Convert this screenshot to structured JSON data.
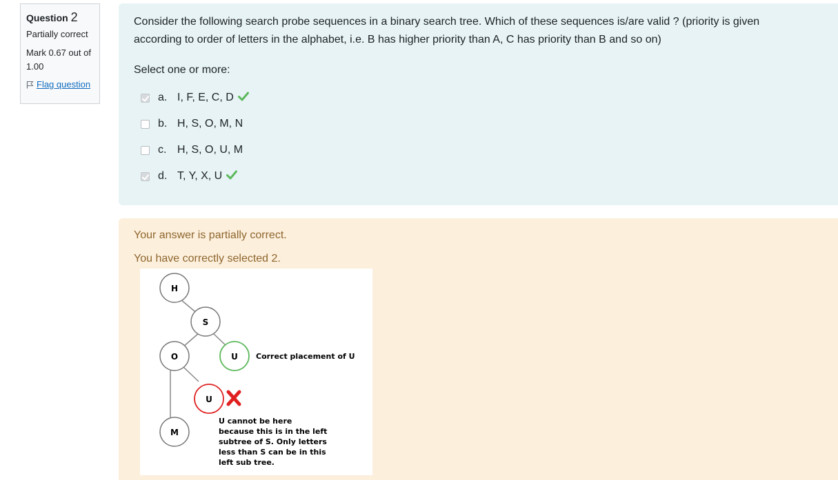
{
  "info": {
    "question_label": "Question",
    "question_number": "2",
    "state": "Partially correct",
    "grade": "Mark 0.67 out of 1.00",
    "flag_label": "Flag question"
  },
  "question": {
    "text": "Consider the following search probe sequences in a binary search tree. Which of these sequences is/are valid ? (priority is given according to order of letters in the alphabet, i.e. B has higher priority than A, C has priority than B and so on)",
    "prompt": "Select one or more:",
    "options": [
      {
        "letter": "a.",
        "text": "I, F, E, C, D",
        "checked": true,
        "correct": true
      },
      {
        "letter": "b.",
        "text": "H, S, O, M, N",
        "checked": false,
        "correct": false
      },
      {
        "letter": "c.",
        "text": "H, S, O, U, M",
        "checked": false,
        "correct": false
      },
      {
        "letter": "d.",
        "text": "T, Y, X, U",
        "checked": true,
        "correct": true
      }
    ]
  },
  "feedback": {
    "status": "Your answer is partially correct.",
    "count": "You have correctly selected 2."
  },
  "diagram": {
    "nodes": {
      "h": "H",
      "s": "S",
      "o": "O",
      "u_correct": "U",
      "u_wrong": "U",
      "m": "M"
    },
    "correct_label": "Correct placement of U",
    "wrong_note_lines": [
      "U cannot be here",
      "because this is in the left",
      "subtree of S. Only letters",
      "less than S can be in this",
      "left sub tree."
    ]
  },
  "colors": {
    "question_bg": "#e7f3f5",
    "feedback_bg": "#fcefdc",
    "feedback_text": "#8e662e",
    "correct_green": "#5cb85c",
    "wrong_red": "#e02020",
    "link_blue": "#0f6cbf"
  }
}
